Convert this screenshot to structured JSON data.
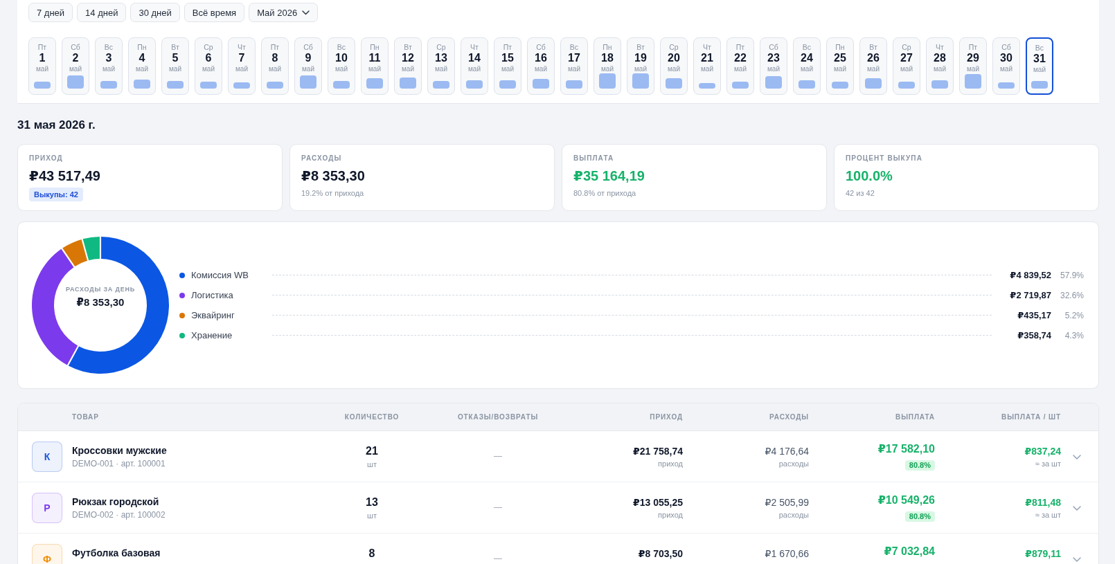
{
  "period_filters": [
    {
      "label": "7 дней",
      "selected": false
    },
    {
      "label": "14 дней",
      "selected": false
    },
    {
      "label": "30 дней",
      "selected": false
    },
    {
      "label": "Всё время",
      "selected": false
    }
  ],
  "month_picker": {
    "label": "Май 2026"
  },
  "days": [
    {
      "weekday": "Пт",
      "day": "1",
      "month": "май",
      "selected": false
    },
    {
      "weekday": "Сб",
      "day": "2",
      "month": "май",
      "selected": false
    },
    {
      "weekday": "Вс",
      "day": "3",
      "month": "май",
      "selected": false
    },
    {
      "weekday": "Пн",
      "day": "4",
      "month": "май",
      "selected": false
    },
    {
      "weekday": "Вт",
      "day": "5",
      "month": "май",
      "selected": false
    },
    {
      "weekday": "Ср",
      "day": "6",
      "month": "май",
      "selected": false
    },
    {
      "weekday": "Чт",
      "day": "7",
      "month": "май",
      "selected": false
    },
    {
      "weekday": "Пт",
      "day": "8",
      "month": "май",
      "selected": false
    },
    {
      "weekday": "Сб",
      "day": "9",
      "month": "май",
      "selected": false
    },
    {
      "weekday": "Вс",
      "day": "10",
      "month": "май",
      "selected": false
    },
    {
      "weekday": "Пн",
      "day": "11",
      "month": "май",
      "selected": false
    },
    {
      "weekday": "Вт",
      "day": "12",
      "month": "май",
      "selected": false
    },
    {
      "weekday": "Ср",
      "day": "13",
      "month": "май",
      "selected": false
    },
    {
      "weekday": "Чт",
      "day": "14",
      "month": "май",
      "selected": false
    },
    {
      "weekday": "Пт",
      "day": "15",
      "month": "май",
      "selected": false
    },
    {
      "weekday": "Сб",
      "day": "16",
      "month": "май",
      "selected": false
    },
    {
      "weekday": "Вс",
      "day": "17",
      "month": "май",
      "selected": false
    },
    {
      "weekday": "Пн",
      "day": "18",
      "month": "май",
      "selected": false
    },
    {
      "weekday": "Вт",
      "day": "19",
      "month": "май",
      "selected": false
    },
    {
      "weekday": "Ср",
      "day": "20",
      "month": "май",
      "selected": false
    },
    {
      "weekday": "Чт",
      "day": "21",
      "month": "май",
      "selected": false
    },
    {
      "weekday": "Пт",
      "day": "22",
      "month": "май",
      "selected": false
    },
    {
      "weekday": "Сб",
      "day": "23",
      "month": "май",
      "selected": false
    },
    {
      "weekday": "Вс",
      "day": "24",
      "month": "май",
      "selected": false
    },
    {
      "weekday": "Пн",
      "day": "25",
      "month": "май",
      "selected": false
    },
    {
      "weekday": "Вт",
      "day": "26",
      "month": "май",
      "selected": false
    },
    {
      "weekday": "Ср",
      "day": "27",
      "month": "май",
      "selected": false
    },
    {
      "weekday": "Чт",
      "day": "28",
      "month": "май",
      "selected": false
    },
    {
      "weekday": "Пт",
      "day": "29",
      "month": "май",
      "selected": false
    },
    {
      "weekday": "Сб",
      "day": "30",
      "month": "май",
      "selected": false
    },
    {
      "weekday": "Вс",
      "day": "31",
      "month": "май",
      "selected": true
    }
  ],
  "date_heading": "31 мая 2026 г.",
  "summary_cards": [
    {
      "label": "ПРИХОД",
      "value": "₽43 517,49",
      "kind": "neutral",
      "badge": "Выкупы: 42"
    },
    {
      "label": "РАСХОДЫ",
      "value": "₽8 353,30",
      "kind": "neutral",
      "note": "19.2% от прихода"
    },
    {
      "label": "ВЫПЛАТА",
      "value": "₽35 164,19",
      "kind": "positive",
      "note": "80.8% от прихода"
    },
    {
      "label": "ПРОЦЕНТ ВЫКУПА",
      "value": "100.0%",
      "kind": "positive",
      "note": "42 из 42"
    }
  ],
  "expenses": {
    "center_label": "РАСХОДЫ ЗА ДЕНЬ",
    "center_value": "₽8 353,30",
    "chart_data": {
      "type": "donut",
      "categories": [
        "Комиссия WB",
        "Логистика",
        "Эквайринг",
        "Хранение"
      ],
      "values": [
        57.9,
        32.6,
        5.2,
        4.3
      ]
    },
    "legend": [
      {
        "color": "#0b57e3",
        "amount": "₽4 839,52",
        "share": "57.9%"
      },
      {
        "color": "#7c3aed",
        "amount": "₽2 719,87",
        "share": "32.6%"
      },
      {
        "color": "#d97706",
        "amount": "₽435,17",
        "share": "5.2%"
      },
      {
        "color": "#10b981",
        "amount": "₽358,74",
        "share": "4.3%"
      }
    ]
  },
  "products": {
    "columns": [
      "ТОВАР",
      "КОЛИЧЕСТВО",
      "ОТКАЗЫ/ВОЗВРАТЫ",
      "ПРИХОД",
      "РАСХОДЫ",
      "ВЫПЛАТА",
      "ВЫПЛАТА / ШТ"
    ],
    "rows": [
      {
        "initial": "К",
        "color": "#1a56db",
        "name": "Кроссовки мужские",
        "sku": "DEMO-001 · арт. 100001",
        "quantity": "21",
        "quantity_unit": "шт",
        "returns": "—",
        "income": "₽21 758,74",
        "income_note": "приход",
        "expenses": "₽4 176,64",
        "expenses_note": "расходы",
        "payout": "₽17 582,10",
        "payout_share": "80.8%",
        "per_unit": "₽837,24",
        "per_unit_note": "≈ за шт",
        "expanded": false
      },
      {
        "initial": "Р",
        "color": "#7c3aed",
        "name": "Рюкзак городской",
        "sku": "DEMO-002 · арт. 100002",
        "quantity": "13",
        "quantity_unit": "шт",
        "returns": "—",
        "income": "₽13 055,25",
        "income_note": "приход",
        "expenses": "₽2 505,99",
        "expenses_note": "расходы",
        "payout": "₽10 549,26",
        "payout_share": "80.8%",
        "per_unit": "₽811,48",
        "per_unit_note": "≈ за шт",
        "expanded": false
      },
      {
        "initial": "Ф",
        "color": "#f08c00",
        "name": "Футболка базовая",
        "quantity": "8",
        "returns": "—",
        "income": "₽8 703,50",
        "expenses": "₽1 670,66",
        "payout": "₽7 032,84",
        "per_unit": "₽879,11",
        "expanded": false
      }
    ]
  }
}
